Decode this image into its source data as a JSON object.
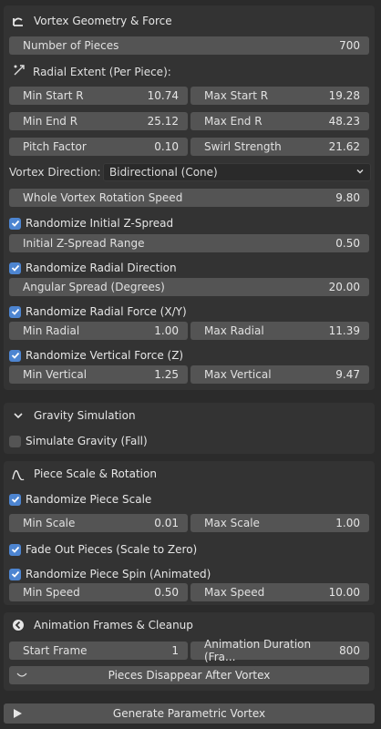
{
  "vortex_panel": {
    "title": "Vortex Geometry & Force",
    "icon": "vortex-geometry-icon",
    "number_of_pieces": {
      "label": "Number of Pieces",
      "value": "700"
    },
    "radial_extent_label": "Radial Extent (Per Piece):",
    "min_start_r": {
      "label": "Min Start R",
      "value": "10.74"
    },
    "max_start_r": {
      "label": "Max Start R",
      "value": "19.28"
    },
    "min_end_r": {
      "label": "Min End R",
      "value": "25.12"
    },
    "max_end_r": {
      "label": "Max End R",
      "value": "48.23"
    },
    "pitch_factor": {
      "label": "Pitch Factor",
      "value": "0.10"
    },
    "swirl_strength": {
      "label": "Swirl Strength",
      "value": "21.62"
    },
    "vortex_direction": {
      "label": "Vortex Direction:",
      "value": "Bidirectional (Cone)"
    },
    "rotation_speed": {
      "label": "Whole Vortex Rotation Speed",
      "value": "9.80"
    },
    "randomize_z_spread": {
      "label": "Randomize Initial Z-Spread",
      "checked": true
    },
    "z_spread_range": {
      "label": "Initial Z-Spread Range",
      "value": "0.50"
    },
    "randomize_radial_direction": {
      "label": "Randomize Radial Direction",
      "checked": true
    },
    "angular_spread": {
      "label": "Angular Spread (Degrees)",
      "value": "20.00"
    },
    "randomize_radial_force": {
      "label": "Randomize Radial Force (X/Y)",
      "checked": true
    },
    "min_radial": {
      "label": "Min Radial",
      "value": "1.00"
    },
    "max_radial": {
      "label": "Max Radial",
      "value": "11.39"
    },
    "randomize_vertical_force": {
      "label": "Randomize Vertical Force (Z)",
      "checked": true
    },
    "min_vertical": {
      "label": "Min Vertical",
      "value": "1.25"
    },
    "max_vertical": {
      "label": "Max Vertical",
      "value": "9.47"
    }
  },
  "gravity_panel": {
    "title": "Gravity Simulation",
    "simulate_gravity": {
      "label": "Simulate Gravity (Fall)",
      "checked": false
    }
  },
  "scale_panel": {
    "title": "Piece Scale & Rotation",
    "randomize_scale": {
      "label": "Randomize Piece Scale",
      "checked": true
    },
    "min_scale": {
      "label": "Min Scale",
      "value": "0.01"
    },
    "max_scale": {
      "label": "Max Scale",
      "value": "1.00"
    },
    "fade_out": {
      "label": "Fade Out Pieces (Scale to Zero)",
      "checked": true
    },
    "randomize_spin": {
      "label": "Randomize Piece Spin (Animated)",
      "checked": true
    },
    "min_speed": {
      "label": "Min Speed",
      "value": "0.50"
    },
    "max_speed": {
      "label": "Max Speed",
      "value": "10.00"
    }
  },
  "animation_panel": {
    "title": "Animation Frames & Cleanup",
    "start_frame": {
      "label": "Start Frame",
      "value": "1"
    },
    "animation_duration": {
      "label": "Animation Duration (Fra...",
      "value": "800"
    },
    "pieces_disappear": {
      "label": "Pieces Disappear After Vortex"
    }
  },
  "generate_button": {
    "label": "Generate Parametric Vortex"
  },
  "colors": {
    "accent": "#4d85d1",
    "panel": "#333333",
    "field": "#545454",
    "background": "#2b2b2b"
  }
}
